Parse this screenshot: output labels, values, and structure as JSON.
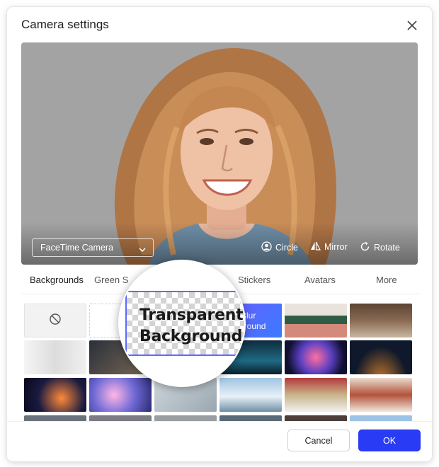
{
  "dialog": {
    "title": "Camera settings",
    "close_icon": "close-icon"
  },
  "preview": {
    "camera_select": "FaceTime Camera",
    "controls": {
      "circle": "Circle",
      "mirror": "Mirror",
      "rotate": "Rotate"
    }
  },
  "tabs": [
    {
      "label": "Backgrounds",
      "active": true
    },
    {
      "label": "Green S"
    },
    {
      "label": "Stickers"
    },
    {
      "label": "Avatars"
    },
    {
      "label": "More"
    }
  ],
  "tiles": {
    "blur_label_line1": "Blur",
    "blur_label_line2": "ckground"
  },
  "magnifier": {
    "line1": "Transparent",
    "line2": "Background"
  },
  "footer": {
    "cancel": "Cancel",
    "ok": "OK"
  },
  "colors": {
    "accent": "#2a3bf5",
    "preview_bg": "#a3a3a3"
  }
}
